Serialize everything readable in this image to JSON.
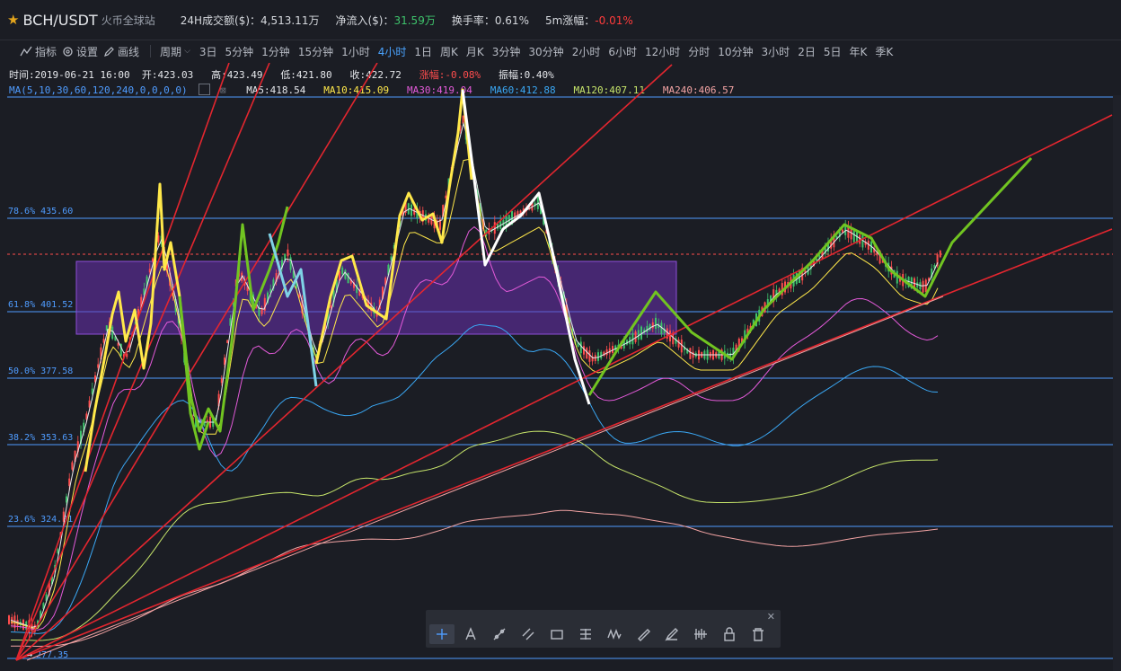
{
  "header": {
    "pair": "BCH/USDT",
    "exchange": "火币全球站",
    "volume_label": "24H成交额($)：",
    "volume_value": "4,513.11万",
    "netflow_label": "净流入($)：",
    "netflow_value": "31.59万",
    "turnover_label": "换手率：",
    "turnover_value": "0.61%",
    "change5m_label": "5m涨幅：",
    "change5m_value": "-0.01%"
  },
  "toolbar": {
    "indicator_label": "指标",
    "settings_label": "设置",
    "draw_label": "画线",
    "period_label": "周期",
    "periods": [
      "3日",
      "5分钟",
      "1分钟",
      "15分钟",
      "1小时",
      "4小时",
      "1日",
      "周K",
      "月K",
      "3分钟",
      "30分钟",
      "2小时",
      "6小时",
      "12小时",
      "分时",
      "10分钟",
      "3小时",
      "2日",
      "5日",
      "年K",
      "季K"
    ],
    "active_period": "4小时"
  },
  "candle_info": {
    "time": "时间:2019-06-21 16:00",
    "open": "开:423.03",
    "high": "高:423.49",
    "low": "低:421.80",
    "close": "收:422.72",
    "change": "涨幅:-0.08%",
    "amplitude": "振幅:0.40%"
  },
  "ma_info": {
    "params": "MA(5,10,30,60,120,240,0,0,0,0)",
    "ma5": "MA5:418.54",
    "ma10": "MA10:415.09",
    "ma30": "MA30:419.04",
    "ma60": "MA60:412.88",
    "ma120": "MA120:407.11",
    "ma240": "MA240:406.57"
  },
  "fib_levels": [
    {
      "label": "78.6% 435.60"
    },
    {
      "label": "61.8% 401.52"
    },
    {
      "label": "50.0% 377.58"
    },
    {
      "label": "38.2% 353.63"
    },
    {
      "label": "23.6% 324.01"
    },
    {
      "label": "277.35"
    }
  ],
  "colors": {
    "background": "#1b1d24",
    "fib_line": "#4f9cff",
    "trend_line": "#e3262f",
    "zigzag_yellow": "#ffe84a",
    "zigzag_green": "#71c421",
    "zigzag_white": "#ffffff",
    "zone_fill": "#6a2fb0",
    "up_candle": "#3ec36b",
    "down_candle": "#ff4d4d",
    "ma5": "#e6e8ec",
    "ma10": "#ffe84a",
    "ma30": "#e35ad9",
    "ma60": "#3aa8f5",
    "ma120": "#c6e46a",
    "ma240": "#f2a3a3"
  },
  "drawing_tools": [
    "crosshair-icon",
    "text-icon",
    "trendline-icon",
    "channel-icon",
    "rectangle-icon",
    "fib-icon",
    "wave-icon",
    "ruler-icon",
    "brush-icon",
    "pattern-icon",
    "lock-icon",
    "trash-icon"
  ]
}
